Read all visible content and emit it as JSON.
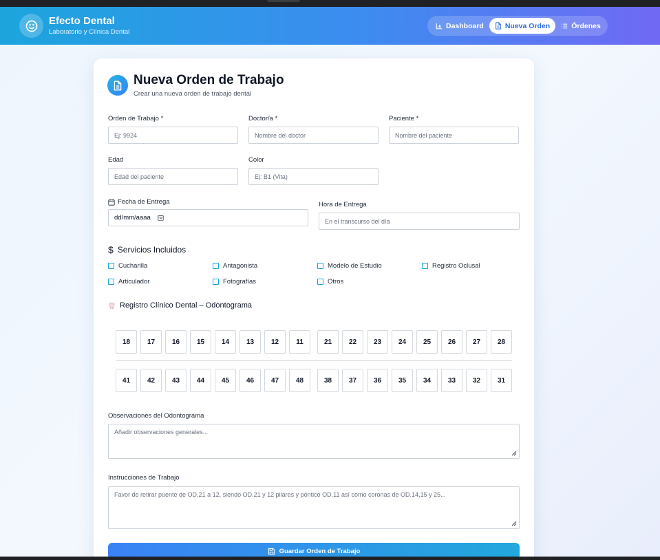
{
  "app": {
    "name": "Efecto Dental",
    "subtitle": "Laboratorio y Clínica Dental"
  },
  "nav": [
    {
      "label": "Dashboard",
      "icon": "bar-chart-icon",
      "active": false
    },
    {
      "label": "Nueva Orden",
      "icon": "document-icon",
      "active": true
    },
    {
      "label": "Órdenes",
      "icon": "list-icon",
      "active": false
    }
  ],
  "form": {
    "title": "Nueva Orden de Trabajo",
    "subtitle": "Crear una nueva orden de trabajo dental",
    "fields": {
      "orden": {
        "label": "Orden de Trabajo *",
        "placeholder": "Ej: 9924",
        "value": ""
      },
      "doctor": {
        "label": "Doctor/a *",
        "placeholder": "Nombre del doctor",
        "value": ""
      },
      "paciente": {
        "label": "Paciente *",
        "placeholder": "Nombre del paciente",
        "value": ""
      },
      "edad": {
        "label": "Edad",
        "placeholder": "Edad del paciente",
        "value": ""
      },
      "color": {
        "label": "Color",
        "placeholder": "Ej: B1 (Vita)",
        "value": ""
      },
      "fecha": {
        "label": "Fecha de Entrega",
        "placeholder": "dd/mm/aaaa"
      },
      "hora": {
        "label": "Hora de Entrega",
        "placeholder": "En el transcurso del día",
        "value": ""
      }
    },
    "services": {
      "title": "Servicios Incluidos",
      "items": [
        {
          "label": "Cucharilla",
          "checked": false
        },
        {
          "label": "Antagonista",
          "checked": false
        },
        {
          "label": "Modelo de Estudio",
          "checked": false
        },
        {
          "label": "Registro Oclusal",
          "checked": false
        },
        {
          "label": "Articulador",
          "checked": false
        },
        {
          "label": "Fotografías",
          "checked": false
        },
        {
          "label": "Otros",
          "checked": false
        }
      ]
    },
    "odontogram": {
      "title": "Registro Clínico Dental – Odontograma",
      "upper": [
        "18",
        "17",
        "16",
        "15",
        "14",
        "13",
        "12",
        "11",
        "21",
        "22",
        "23",
        "24",
        "25",
        "26",
        "27",
        "28"
      ],
      "lower": [
        "41",
        "42",
        "43",
        "44",
        "45",
        "46",
        "47",
        "48",
        "38",
        "37",
        "36",
        "35",
        "34",
        "33",
        "32",
        "31"
      ]
    },
    "observaciones": {
      "label": "Observaciones del Odontograma",
      "placeholder": "Añadir observaciones generales...",
      "value": ""
    },
    "instrucciones": {
      "label": "Instrucciones de Trabajo",
      "placeholder": "Favor de retirar puente de OD.21 a 12, siendo OD.21 y 12 pilares y póntico OD.11 así como coronas de OD.14,15 y 25...",
      "value": ""
    },
    "save_label": "Guardar Orden de Trabajo"
  }
}
